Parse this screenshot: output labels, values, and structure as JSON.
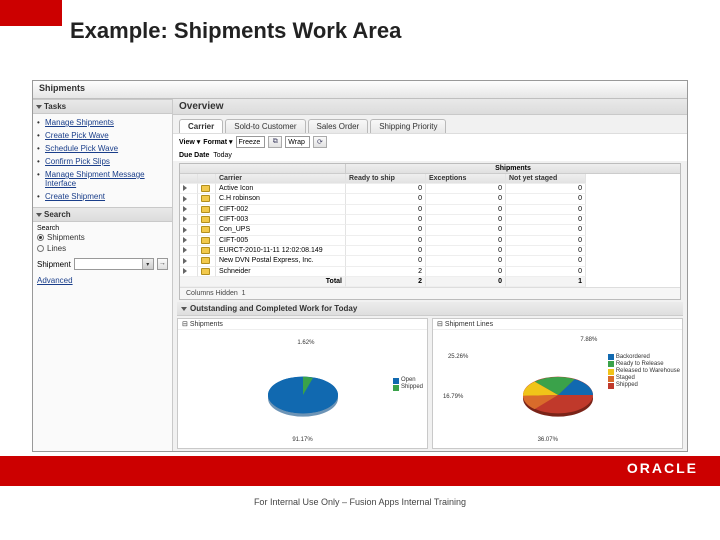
{
  "slide": {
    "title": "Example: Shipments Work Area",
    "footer": "For Internal Use Only – Fusion Apps Internal Training",
    "logo": "ORACLE"
  },
  "app": {
    "title": "Shipments"
  },
  "sidebar": {
    "tasks_header": "Tasks",
    "tasks": [
      "Manage Shipments",
      "Create Pick Wave",
      "Schedule Pick Wave",
      "Confirm Pick Slips",
      "Manage Shipment Message Interface",
      "Create Shipment"
    ],
    "search_header": "Search",
    "search_radios": {
      "shipments": "Shipments",
      "lines": "Lines"
    },
    "shipment_label": "Shipment",
    "advanced": "Advanced"
  },
  "overview": {
    "header": "Overview",
    "tabs": [
      "Carrier",
      "Sold-to Customer",
      "Sales Order",
      "Shipping Priority"
    ],
    "toolbar": {
      "view": "View",
      "format": "Format",
      "freeze": "Freeze",
      "wrap": "Wrap"
    },
    "due": {
      "label": "Due Date",
      "value": "Today"
    },
    "table": {
      "super": "Shipments",
      "cols": [
        "Carrier",
        "Ready to ship",
        "Exceptions",
        "Not yet staged"
      ],
      "rows": [
        {
          "name": "Active Icon",
          "r": 0,
          "e": 0,
          "n": 0
        },
        {
          "name": "C.H robinson",
          "r": 0,
          "e": 0,
          "n": 0
        },
        {
          "name": "CIFT-002",
          "r": 0,
          "e": 0,
          "n": 0
        },
        {
          "name": "CIFT-003",
          "r": 0,
          "e": 0,
          "n": 0
        },
        {
          "name": "Con_UPS",
          "r": 0,
          "e": 0,
          "n": 0
        },
        {
          "name": "CIFT-005",
          "r": 0,
          "e": 0,
          "n": 0
        },
        {
          "name": "EURCT-2010-11-11 12:02:08.149",
          "r": 0,
          "e": 0,
          "n": 0
        },
        {
          "name": "New DVN Postal Express, Inc.",
          "r": 0,
          "e": 0,
          "n": 0
        },
        {
          "name": "Schneider",
          "r": 2,
          "e": 0,
          "n": 0
        }
      ],
      "total_label": "Total",
      "total": {
        "r": 2,
        "e": 0,
        "n": 1
      },
      "columns_hidden_label": "Columns Hidden",
      "columns_hidden": "1"
    }
  },
  "charts_header": "Outstanding and Completed Work for Today",
  "chart_data": [
    {
      "type": "pie",
      "title": "Shipments",
      "series": [
        {
          "name": "Open",
          "value": 91.17,
          "color": "#1169b0"
        },
        {
          "name": "Shipped",
          "value": 1.62,
          "color": "#3aa24a"
        }
      ],
      "labels": [
        "91.17%",
        "1.62%"
      ]
    },
    {
      "type": "pie",
      "title": "Shipment Lines",
      "series": [
        {
          "name": "Backordered",
          "value": 7.88,
          "color": "#1169b0"
        },
        {
          "name": "Ready to Release",
          "value": 25.26,
          "color": "#3aa24a"
        },
        {
          "name": "Released to Warehouse",
          "value": 16.79,
          "color": "#f0c419"
        },
        {
          "name": "Staged",
          "value": 14.0,
          "color": "#d96b2b"
        },
        {
          "name": "Shipped",
          "value": 36.07,
          "color": "#c0392b"
        }
      ],
      "labels": [
        "7.88%",
        "25.26%",
        "16.79%",
        "36.07%"
      ]
    }
  ]
}
